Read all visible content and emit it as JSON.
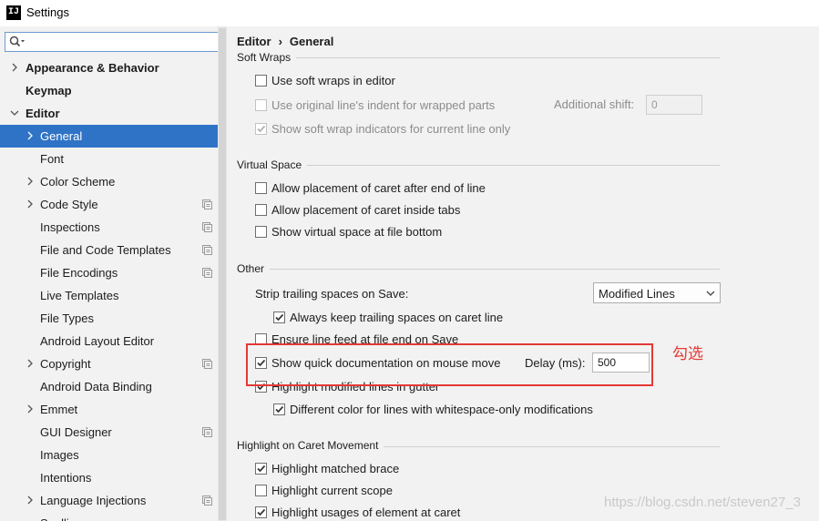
{
  "window": {
    "title": "Settings",
    "app_icon": "IJ"
  },
  "sidebar": {
    "search": {
      "placeholder": ""
    },
    "items": [
      {
        "label": "Appearance & Behavior",
        "bold": true,
        "arrow": "right",
        "indent": 0
      },
      {
        "label": "Keymap",
        "bold": true,
        "arrow": "",
        "indent": 0
      },
      {
        "label": "Editor",
        "bold": true,
        "arrow": "down",
        "indent": 0
      },
      {
        "label": "General",
        "bold": false,
        "arrow": "right",
        "indent": 1,
        "selected": true
      },
      {
        "label": "Font",
        "bold": false,
        "arrow": "",
        "indent": 1
      },
      {
        "label": "Color Scheme",
        "bold": false,
        "arrow": "right",
        "indent": 1
      },
      {
        "label": "Code Style",
        "bold": false,
        "arrow": "right",
        "indent": 1,
        "badge": true
      },
      {
        "label": "Inspections",
        "bold": false,
        "arrow": "",
        "indent": 1,
        "badge": true
      },
      {
        "label": "File and Code Templates",
        "bold": false,
        "arrow": "",
        "indent": 1,
        "badge": true
      },
      {
        "label": "File Encodings",
        "bold": false,
        "arrow": "",
        "indent": 1,
        "badge": true
      },
      {
        "label": "Live Templates",
        "bold": false,
        "arrow": "",
        "indent": 1
      },
      {
        "label": "File Types",
        "bold": false,
        "arrow": "",
        "indent": 1
      },
      {
        "label": "Android Layout Editor",
        "bold": false,
        "arrow": "",
        "indent": 1
      },
      {
        "label": "Copyright",
        "bold": false,
        "arrow": "right",
        "indent": 1,
        "badge": true
      },
      {
        "label": "Android Data Binding",
        "bold": false,
        "arrow": "",
        "indent": 1
      },
      {
        "label": "Emmet",
        "bold": false,
        "arrow": "right",
        "indent": 1
      },
      {
        "label": "GUI Designer",
        "bold": false,
        "arrow": "",
        "indent": 1,
        "badge": true
      },
      {
        "label": "Images",
        "bold": false,
        "arrow": "",
        "indent": 1
      },
      {
        "label": "Intentions",
        "bold": false,
        "arrow": "",
        "indent": 1
      },
      {
        "label": "Language Injections",
        "bold": false,
        "arrow": "right",
        "indent": 1,
        "badge": true
      },
      {
        "label": "Spelling",
        "bold": false,
        "arrow": "",
        "indent": 1
      }
    ]
  },
  "breadcrumb": {
    "parent": "Editor",
    "separator": "›",
    "current": "General"
  },
  "soft_wraps": {
    "title": "Soft Wraps",
    "use_soft_wraps": {
      "label": "Use soft wraps in editor",
      "checked": false,
      "enabled": true
    },
    "use_original_indent": {
      "label": "Use original line's indent for wrapped parts",
      "checked": false,
      "enabled": false
    },
    "additional_shift": {
      "label": "Additional shift:",
      "value": "0",
      "enabled": false
    },
    "show_indicators": {
      "label": "Show soft wrap indicators for current line only",
      "checked": true,
      "enabled": false
    }
  },
  "virtual_space": {
    "title": "Virtual Space",
    "after_end_of_line": {
      "label": "Allow placement of caret after end of line",
      "checked": false
    },
    "inside_tabs": {
      "label": "Allow placement of caret inside tabs",
      "checked": false
    },
    "at_file_bottom": {
      "label": "Show virtual space at file bottom",
      "checked": false
    }
  },
  "other": {
    "title": "Other",
    "strip_trailing": {
      "label": "Strip trailing spaces on Save:",
      "selected": "Modified Lines"
    },
    "keep_trailing": {
      "label": "Always keep trailing spaces on caret line",
      "checked": true
    },
    "ensure_line_feed": {
      "label": "Ensure line feed at file end on Save",
      "checked": false
    },
    "quick_doc": {
      "label": "Show quick documentation on mouse move",
      "checked": true
    },
    "delay": {
      "label": "Delay (ms):",
      "value": "500"
    },
    "highlight_modified": {
      "label": "Highlight modified lines in gutter",
      "checked": true
    },
    "different_color": {
      "label": "Different color for lines with whitespace-only modifications",
      "checked": true
    }
  },
  "caret_movement": {
    "title": "Highlight on Caret Movement",
    "matched_brace": {
      "label": "Highlight matched brace",
      "checked": true
    },
    "current_scope": {
      "label": "Highlight current scope",
      "checked": false
    },
    "usages": {
      "label": "Highlight usages of element at caret",
      "checked": true
    }
  },
  "annotation": {
    "text": "勾选",
    "color": "#e53935"
  },
  "watermark": "https://blog.csdn.net/steven27_3",
  "colors": {
    "accent": "#2f73c6",
    "sidebar_bg": "#f2f2f2",
    "highlight_box": "#e53935"
  }
}
